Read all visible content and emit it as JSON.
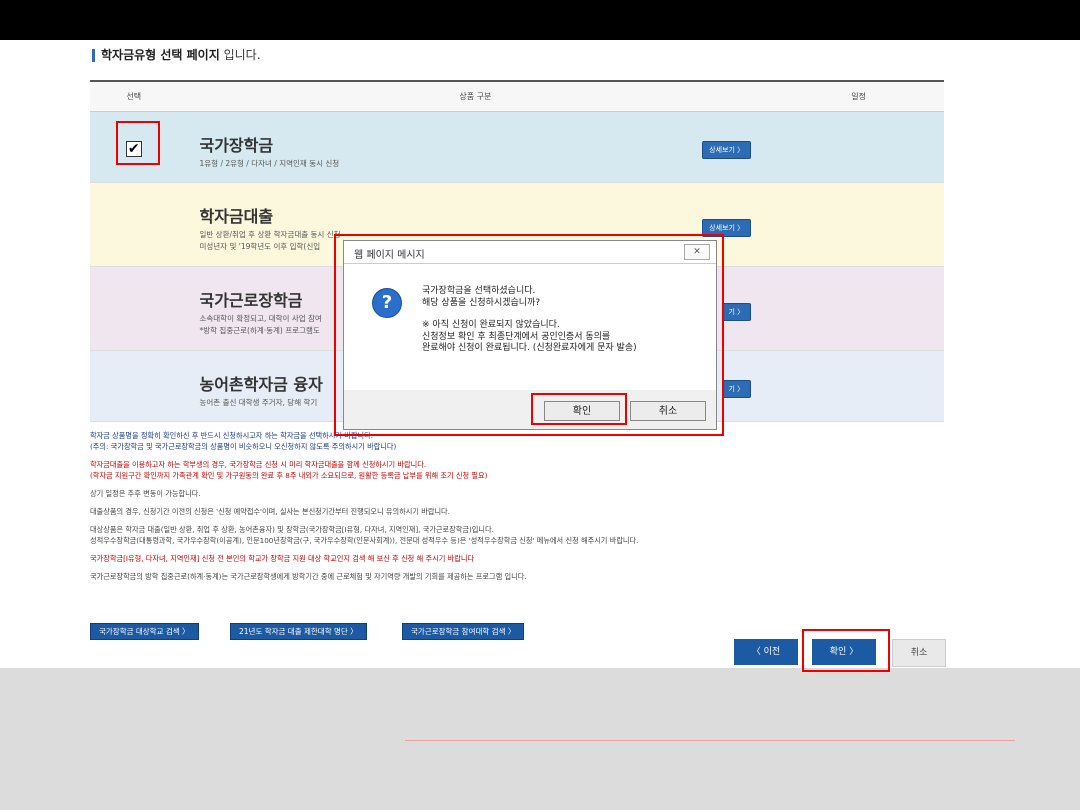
{
  "page": {
    "title_bold": "학자금유형 선택 페이지",
    "title_rest": " 입니다."
  },
  "table": {
    "headers": [
      "선택",
      "상품 구분",
      "일정"
    ],
    "rows": [
      {
        "name": "국가장학금",
        "sub1": "1유형 / 2유형 / 다자녀 / 지역인재 동시 신청",
        "sub2": "",
        "detail": "상세보기 〉",
        "checked": "✔"
      },
      {
        "name": "학자금대출",
        "sub1": "일반 상환/취업 후 상환 학자금대출 동시 신청",
        "sub2": "미성년자 및 '19학년도 이후 입학(신입",
        "detail": "상세보기 〉",
        "checked": ""
      },
      {
        "name": "국가근로장학금",
        "sub1": "소속대학이 확정되고, 대학이 사업 참여",
        "sub2": "*방학 집중근로(하계·동계) 프로그램도",
        "detail": "기 〉",
        "checked": ""
      },
      {
        "name": "농어촌학자금 융자",
        "sub1": "농어촌 출신 대학생 주거자, 당해 학기",
        "sub2": "",
        "detail": "기 〉",
        "checked": ""
      }
    ]
  },
  "notes": [
    {
      "text": "학자금 상품명을 정확히 확인하신 후 반드시 신청하시고자 하는 학자금을 선택하시기 바랍니다.",
      "cls": "blue"
    },
    {
      "text": "(주의: 국가장학금 및 국가근로장학금의 상품명이 비슷하오니 오신청하지 않도록 주의하시기 바랍니다)",
      "cls": "blue"
    },
    {
      "text": "학자금대출을 이용하고자 하는 학부생의 경우, 국가장학금 신청 시 미리 학자금대출을 함께 신청하시기 바랍니다.",
      "cls": "red"
    },
    {
      "text": "(학자금 지원구간 확인까지 가족관계 확인 및 가구원동의 완료 후 8주 내외가 소요되므로, 원활한 등록금 납부를 위해 조기 신청 필요)",
      "cls": "red"
    },
    {
      "text": "상기 일정은 추후 변동이 가능합니다.",
      "cls": ""
    },
    {
      "text": "대출상품의 경우, 신청기간 이전의 신청은 '신청 예약접수'이며, 실사는 본신청기간부터 진행되오니 유의하시기 바랍니다.",
      "cls": ""
    },
    {
      "text": "대상상품은 학자금 대출(일반 상환, 취업 후 상환, 농어촌융자) 및 장학금(국가장학금[I유형, 다자녀, 지역인재], 국가근로장학금)입니다.",
      "cls": ""
    },
    {
      "text": "성적우수장학금(대통령과학, 국가우수장학(이공계), 인문100년장학금(구, 국가우수장학(인문사회계)), 전문대 성적우수 등)은 '성적우수장학금 신청' 메뉴에서 신청 해주시기 바랍니다.",
      "cls": ""
    },
    {
      "text": "국가장학금[I유형, 다자녀, 지역인재] 신청 전 본인의 학교가 장학금 지원 대상 학교인지 검색 해 보신 후 신청 해 주시기 바랍니다",
      "cls": "red"
    },
    {
      "text": "국가근로장학금의 방학 집중근로(하계·동계)는 국가근로장학생에게 방학기간 중에 근로체험 및 자기역량 개발의 기회를 제공하는 프로그램 입니다.",
      "cls": ""
    }
  ],
  "links": [
    "국가장학금 대상학교 검색 〉",
    "21년도 학자금 대출 제한대학 명단 〉",
    "국가근로장학금 참여대학 검색 〉"
  ],
  "nav": {
    "prev": "〈 이전",
    "ok": "확인 〉",
    "cancel": "취소"
  },
  "dialog": {
    "title": "웹 페이지 메시지",
    "close": "✕",
    "icon": "?",
    "line1": "국가장학금을 선택하셨습니다.",
    "line2": "해당 상품을 신청하시겠습니까?",
    "line3": "※ 아직 신청이 완료되지 않았습니다.",
    "line4": "신청정보 확인 후 최종단계에서 공인인증서 동의를",
    "line5": "완료해야 신청이 완료됩니다. (신청완료자에게 문자 발송)",
    "ok": "확인",
    "cancel": "취소"
  },
  "colors": {
    "accent": "#1c5aa3",
    "highlight": "#e00000"
  }
}
